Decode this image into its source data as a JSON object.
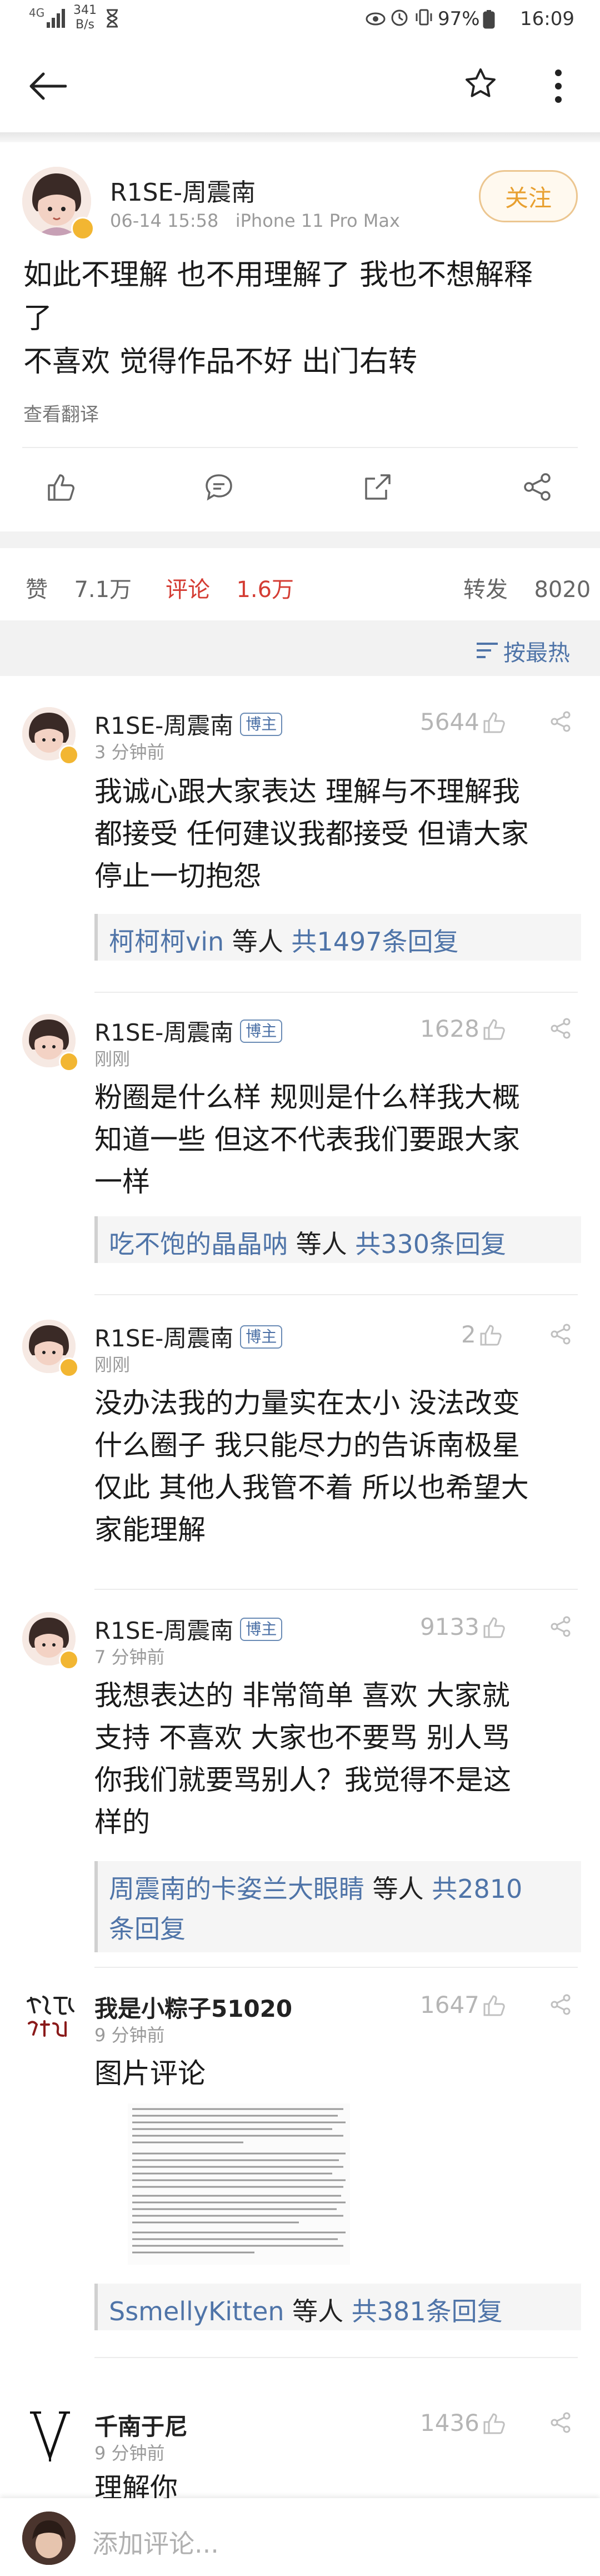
{
  "status": {
    "net": "4G",
    "speed": "341",
    "speed_unit": "B/s",
    "battery": "97%",
    "time": "16:09"
  },
  "post": {
    "author": "R1SE-周震南",
    "date": "06-14 15:58",
    "device": "iPhone 11 Pro Max",
    "follow_label": "关注",
    "text_line1": "如此不理解 也不用理解了 我也不想解释",
    "text_line2": "了",
    "text_line3": "不喜欢 觉得作品不好 出门右转",
    "translate_label": "查看翻译"
  },
  "stats": {
    "like_label": "赞",
    "like_count": "7.1万",
    "comment_label": "评论",
    "comment_count": "1.6万",
    "repost_label": "转发",
    "repost_count": "8020",
    "sort_label": "按最热"
  },
  "comments": [
    {
      "author": "R1SE-周震南",
      "badge": "博主",
      "time": "3 分钟前",
      "likes": "5644",
      "lines": [
        "我诚心跟大家表达 理解与不理解我",
        "都接受 任何建议我都接受 但请大家",
        "停止一切抱怨"
      ],
      "reply_user": "柯柯柯vin",
      "reply_mid": " 等人 ",
      "reply_total": "共1497条回复"
    },
    {
      "author": "R1SE-周震南",
      "badge": "博主",
      "time": "刚刚",
      "likes": "1628",
      "lines": [
        "粉圈是什么样 规则是什么样我大概",
        "知道一些 但这不代表我们要跟大家",
        "一样"
      ],
      "reply_user": "吃不饱的晶晶呐",
      "reply_mid": " 等人 ",
      "reply_total": "共330条回复"
    },
    {
      "author": "R1SE-周震南",
      "badge": "博主",
      "time": "刚刚",
      "likes": "2",
      "lines": [
        "没办法我的力量实在太小 没法改变",
        "什么圈子 我只能尽力的告诉南极星",
        "仅此 其他人我管不着 所以也希望大",
        "家能理解"
      ]
    },
    {
      "author": "R1SE-周震南",
      "badge": "博主",
      "time": "7 分钟前",
      "likes": "9133",
      "lines": [
        "我想表达的 非常简单 喜欢 大家就",
        "支持 不喜欢 大家也不要骂 别人骂",
        "你我们就要骂别人？我觉得不是这",
        "样的"
      ],
      "reply_user": "周震南的卡姿兰大眼睛",
      "reply_mid": " 等人 ",
      "reply_total_a": "共2810",
      "reply_total_b": "条回复"
    },
    {
      "author": "我是小粽子51020",
      "time": "9 分钟前",
      "likes": "1647",
      "lines": [
        "图片评论"
      ],
      "reply_user": "SsmellyKitten",
      "reply_mid": " 等人 ",
      "reply_total": "共381条回复"
    },
    {
      "author": "千南于尼",
      "time": "9 分钟前",
      "likes": "1436",
      "lines": [
        "理解你"
      ]
    }
  ],
  "compose": {
    "placeholder": "添加评论..."
  },
  "colors": {
    "accent_orange": "#e8a030",
    "link_blue": "#4f74a8",
    "comment_red": "#d43c33"
  }
}
